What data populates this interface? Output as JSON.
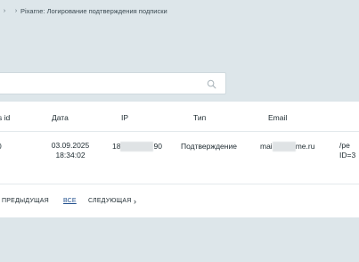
{
  "breadcrumb": {
    "parent": "",
    "current": "Pixarne: Логирование подтверждения подписки"
  },
  "search": {
    "placeholder": "",
    "value": ""
  },
  "table": {
    "columns": [
      "s id",
      "Дата",
      "IP",
      "Тип",
      "Email",
      ""
    ],
    "rows": [
      {
        "id": "0",
        "date": "03.09.2025",
        "time": "18:34:02",
        "ip_start": "18",
        "ip_end": "90",
        "type": "Подтверждение",
        "email_start": "mai",
        "email_end": "me.ru",
        "url_line1": "/pe",
        "url_line2": "ID=3"
      }
    ]
  },
  "pager": {
    "prev": "ПРЕДЫДУЩАЯ",
    "all": "ВСЕ",
    "next": "СЛЕДУЮЩАЯ"
  },
  "icons": {
    "breadcrumb_separator": "chevron-right-icon",
    "search": "search-icon",
    "next": "chevron-right-icon"
  }
}
